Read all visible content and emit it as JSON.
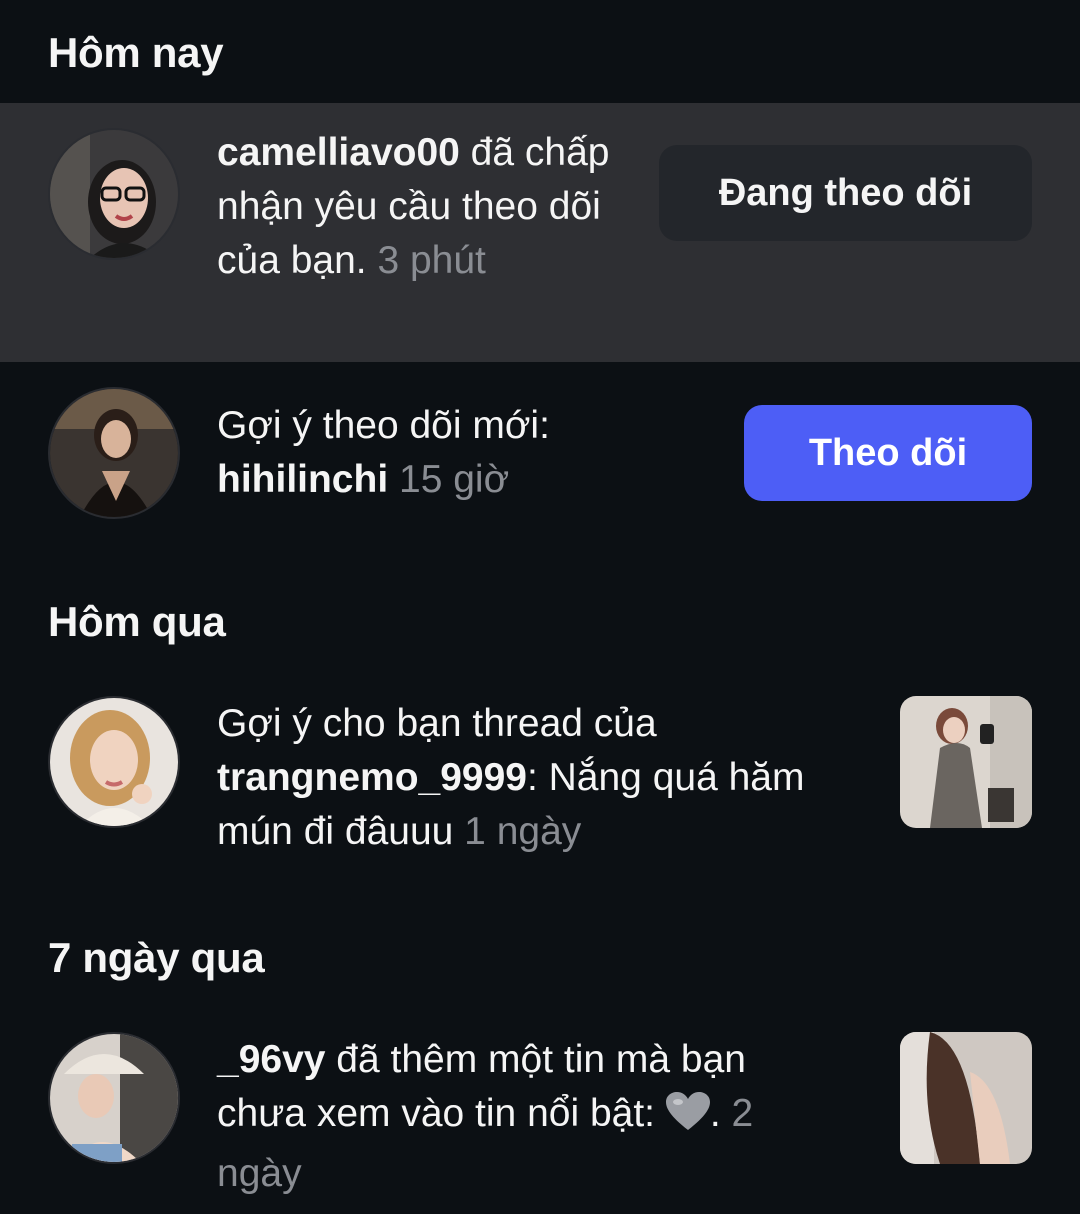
{
  "sections": {
    "today": {
      "title": "Hôm nay"
    },
    "yesterday": {
      "title": "Hôm qua"
    },
    "last7": {
      "title": "7 ngày qua"
    }
  },
  "notifications": [
    {
      "username": "camelliavo00",
      "text": " đã chấp nhận yêu cầu theo dõi của bạn.",
      "time": " 3 phút",
      "action_label": "Đang theo dõi",
      "avatar_icon": "avatar-woman-glasses"
    },
    {
      "prefix": "Gợi ý theo dõi mới: ",
      "username": "hihilinchi",
      "time": " 15 giờ",
      "action_label": "Theo dõi",
      "avatar_icon": "avatar-woman-dark-outfit"
    },
    {
      "prefix": "Gợi ý cho bạn thread của ",
      "username": "trangnemo_9999",
      "text": ": Nắng quá hăm mún đi đâuuu",
      "time": " 1 ngày",
      "avatar_icon": "avatar-woman-blonde",
      "thumbnail": "thread-photo-mirror-selfie"
    },
    {
      "username": "_96vy",
      "text": " đã thêm một tin mà bạn chưa xem vào tin nổi bật: ",
      "emoji": "grey-heart-emoji",
      "text_after": ".",
      "time": " 2 ngày",
      "avatar_icon": "avatar-woman-hat",
      "thumbnail": "story-photo-hair"
    }
  ],
  "colors": {
    "background": "#0c1014",
    "highlight_row": "#2e2f33",
    "follow_button": "#4d5ef6",
    "following_button": "#23262b",
    "secondary_text": "#8a8d93"
  }
}
